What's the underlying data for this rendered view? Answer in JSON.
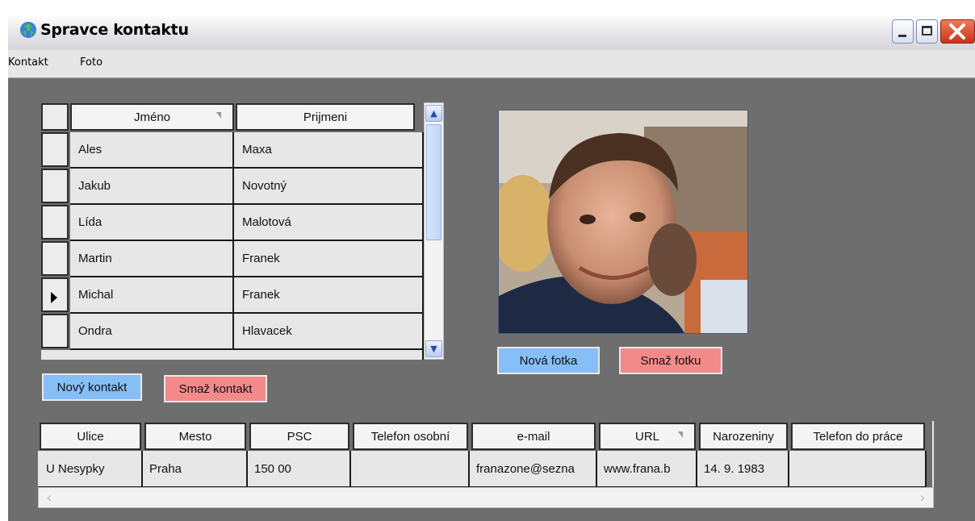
{
  "window": {
    "title": "Spravce kontaktu",
    "icon": "recycle-globe-icon"
  },
  "menu": [
    "Kontakt",
    "Foto"
  ],
  "contacts_table": {
    "headers": [
      "Jméno",
      "Prijmeni"
    ],
    "sorted_column": "Jméno",
    "selected_row": 4,
    "rows": [
      {
        "jmeno": "Ales",
        "prijmeni": "Maxa"
      },
      {
        "jmeno": "Jakub",
        "prijmeni": "Novotný"
      },
      {
        "jmeno": "Lída",
        "prijmeni": "Malotová"
      },
      {
        "jmeno": "Martin",
        "prijmeni": "Franek"
      },
      {
        "jmeno": "Michal",
        "prijmeni": "Franek"
      },
      {
        "jmeno": "Ondra",
        "prijmeni": "Hlavacek"
      }
    ]
  },
  "contact_buttons": {
    "new": "Nový kontakt",
    "delete": "Smaž kontakt"
  },
  "photo_buttons": {
    "new": "Nová fotka",
    "delete": "Smaž fotku"
  },
  "details_table": {
    "headers": [
      "Ulice",
      "Mesto",
      "PSC",
      "Telefon osobní",
      "e-mail",
      "URL",
      "Narozeniny",
      "Telefon do práce"
    ],
    "sorted_column": "URL",
    "row": [
      "U Nesypky",
      "Praha",
      "150 00",
      "",
      "franazone@sezna",
      "www.frana.b",
      "14. 9. 1983",
      ""
    ]
  },
  "colors": {
    "background": "#6e6e6e",
    "button_blue": "#86bef6",
    "button_red": "#f38a8a",
    "cell": "#e7e7e7"
  }
}
